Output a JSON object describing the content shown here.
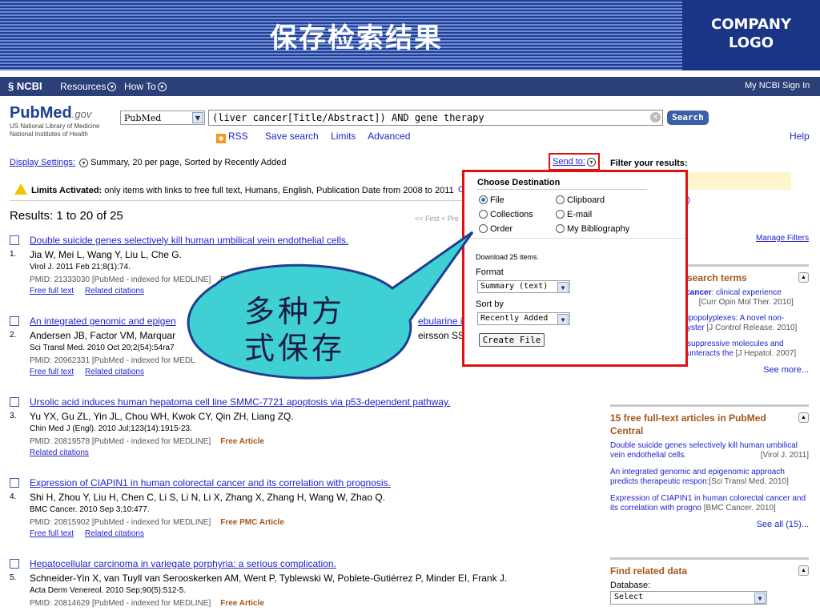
{
  "slide": {
    "title": "保存检索结果",
    "logo_line1": "COMPANY",
    "logo_line2": "LOGO"
  },
  "ncbi_bar": {
    "logo": "NCBI",
    "resources": "Resources",
    "howto": "How To",
    "myncbi": "My NCBI",
    "signin": "Sign In"
  },
  "header": {
    "logo_word": "PubMed",
    "logo_gov": ".gov",
    "logo_sub1": "US National Library of Medicine",
    "logo_sub2": "National Institutes of Health",
    "db": "PubMed",
    "query": "(liver cancer[Title/Abstract]) AND gene therapy",
    "search_label": "Search",
    "rss": "RSS",
    "save_search": "Save search",
    "limits": "Limits",
    "advanced": "Advanced",
    "help": "Help"
  },
  "display": {
    "label": "Display Settings:",
    "value": "Summary, 20 per page, Sorted by Recently Added",
    "send_to": "Send to:"
  },
  "limits": {
    "bold": "Limits Activated:",
    "text": "only items with links to free full text, Humans, English, Publication Date from 2008 to 2011",
    "link": "C"
  },
  "results_header": "Results: 1 to 20 of 25",
  "pager": "<< First  < Pre",
  "filters": {
    "title": "Filter your results:",
    "count": "5)",
    "manage": "Manage Filters"
  },
  "results": [
    {
      "num": "1.",
      "title": "Double suicide genes selectively kill human umbilical vein endothelial cells.",
      "authors": "Jia W, Mei L, Wang Y, Liu L, Che G.",
      "journal": "Virol J. 2011 Feb 21;8(1):74.",
      "pmid": "PMID: 21333030 [PubMed - indexed for MEDLINE]",
      "free": "Free PMC Article",
      "links": [
        "Free full text",
        "Related citations"
      ]
    },
    {
      "num": "2.",
      "title": "An integrated genomic and epigen",
      "title_end": "ebularine in",
      "authors": "Andersen JB, Factor VM, Marquar",
      "authors_end": "eirsson SS.",
      "journal": "Sci Transl Med. 2010 Oct 20;2(54):54ra7",
      "pmid": "PMID: 20962331 [PubMed - indexed for MEDL",
      "free": "",
      "links": [
        "Free full text",
        "Related citations"
      ]
    },
    {
      "num": "3.",
      "title": "Ursolic acid induces human hepatoma cell line SMMC-7721 apoptosis via p53-dependent pathway.",
      "authors": "Yu YX, Gu ZL, Yin JL, Chou WH, Kwok CY, Qin ZH, Liang ZQ.",
      "journal": "Chin Med J (Engl). 2010 Jul;123(14):1915-23.",
      "pmid": "PMID: 20819578 [PubMed - indexed for MEDLINE]",
      "free": "Free Article",
      "links": [
        "Related citations"
      ]
    },
    {
      "num": "4.",
      "title": "Expression of CIAPIN1 in human colorectal cancer and its correlation with prognosis.",
      "authors": "Shi H, Zhou Y, Liu H, Chen C, Li S, Li N, Li X, Zhang X, Zhang H, Wang W, Zhao Q.",
      "journal": "BMC Cancer. 2010 Sep 3;10:477.",
      "pmid": "PMID: 20815902 [PubMed - indexed for MEDLINE]",
      "free": "Free PMC Article",
      "links": [
        "Free full text",
        "Related citations"
      ]
    },
    {
      "num": "5.",
      "title": "Hepatocellular carcinoma in variegate porphyria: a serious complication.",
      "authors": "Schneider-Yin X, van Tuyll van Serooskerken AM, Went P, Tyblewski W, Poblete-Gutiérrez P, Minder EI, Frank J.",
      "journal": "Acta Derm Venereol. 2010 Sep;90(5):512-5.",
      "pmid": "PMID: 20814629 [PubMed - indexed for MEDLINE]",
      "free": "Free Article",
      "links": []
    }
  ],
  "popup": {
    "title": "Choose Destination",
    "options": [
      "File",
      "Clipboard",
      "Collections",
      "E-mail",
      "Order",
      "My Bibliography"
    ],
    "selected": "File",
    "download": "Download 25 items.",
    "format_label": "Format",
    "format_value": "Summary (text)",
    "sort_label": "Sort by",
    "sort_value": "Recently Added",
    "create": "Create File"
  },
  "callout": {
    "line1": "多种方",
    "line2": "式保存"
  },
  "right": {
    "terms_head": "search terms",
    "terms": [
      {
        "pre": "",
        "bold": "er cancer",
        "text": ": clinical experience",
        "line2": "s,",
        "src": "[Curr Opin Mol Ther. 2010]"
      },
      {
        "pre": "",
        "bold": "",
        "text": "ipopolyplexes: A novel non-",
        "line2": "yster",
        "src": "[J Control Release. 2010]"
      },
      {
        "pre": "",
        "bold": "",
        "text": "suppressive molecules and",
        "line2": "unteracts the",
        "src": "[J Hepatol. 2007]"
      }
    ],
    "see_more": "See more...",
    "free_head": "15 free full-text articles in PubMed Central",
    "free": [
      {
        "text": "Double suicide genes selectively kill human umbilical vein endothelial cells.",
        "src": "[Virol J. 2011]"
      },
      {
        "text": "An integrated genomic and epigenomic approach predicts therapeutic respon:",
        "src": "[Sci Transl Med. 2010]"
      },
      {
        "text": "Expression of CIAPIN1 in human colorectal cancer and its correlation with progno",
        "src": "[BMC Cancer. 2010]"
      }
    ],
    "see_all": "See all (15)...",
    "related_head": "Find related data",
    "db_label": "Database:",
    "db_value": "Select"
  }
}
